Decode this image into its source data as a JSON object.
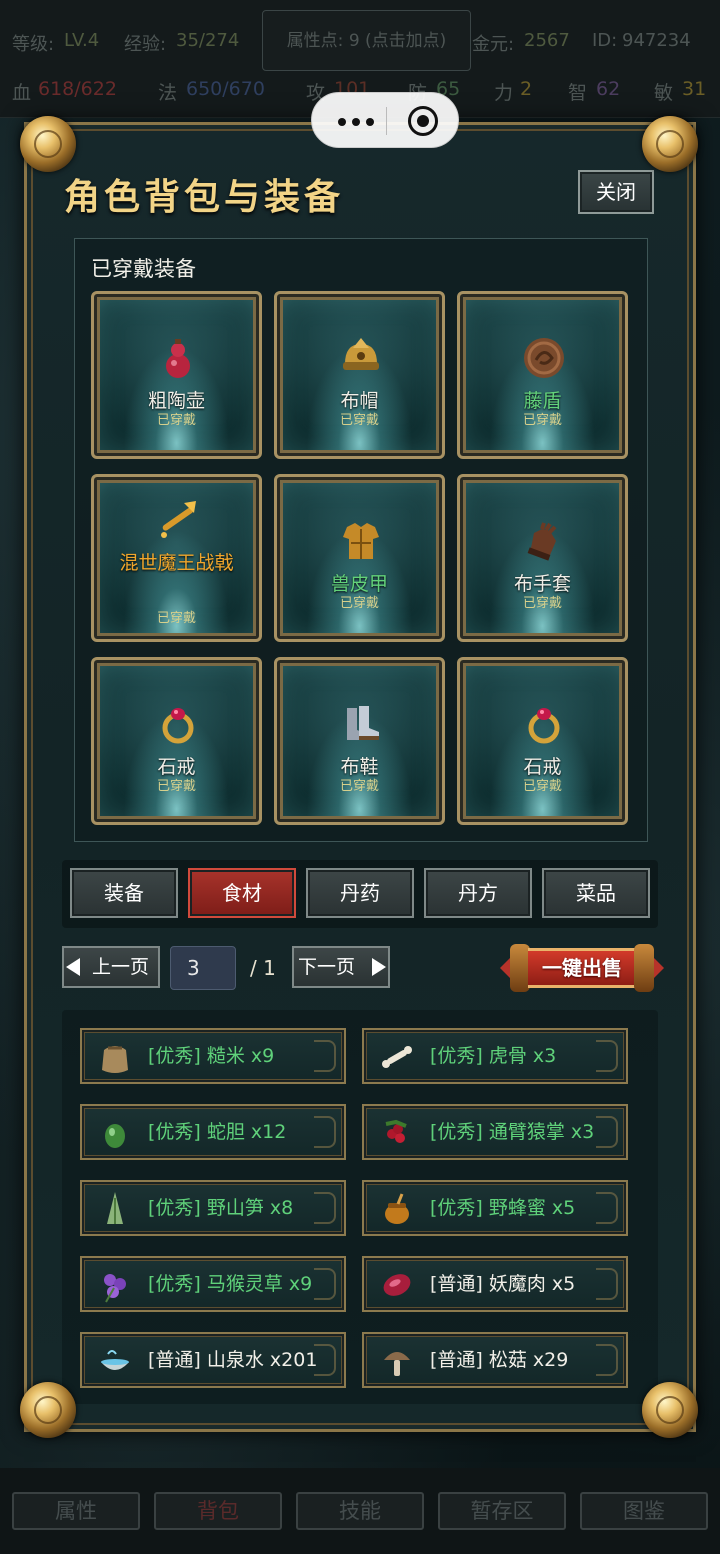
{
  "status": {
    "level_label": "等级:",
    "level_value": "LV.4",
    "exp_label": "经验:",
    "exp_value": "35/274",
    "attr_points": "属性点: 9 (点击加点)",
    "gold_label": "金元:",
    "gold_value": "2567",
    "id_label": "ID:",
    "id_value": "947234",
    "hp_label": "血",
    "hp_value": "618/622",
    "mp_label": "法",
    "mp_value": "650/670",
    "atk_label": "攻",
    "atk_value": "101",
    "def_label": "防",
    "def_value": "65",
    "str_label": "力",
    "str_value": "2",
    "int_label": "智",
    "int_value": "62",
    "agi_label": "敏",
    "agi_value": "31"
  },
  "panel": {
    "title": "角色背包与装备",
    "close_label": "关闭",
    "equipped_title": "已穿戴装备"
  },
  "equipped": [
    {
      "name": "粗陶壶",
      "sub": "已穿戴",
      "icon": "gourd-icon",
      "rarity": "normal"
    },
    {
      "name": "布帽",
      "sub": "已穿戴",
      "icon": "helmet-icon",
      "rarity": "normal"
    },
    {
      "name": "藤盾",
      "sub": "已穿戴",
      "icon": "shield-icon",
      "rarity": "good"
    },
    {
      "name": "混世魔王战戟",
      "sub": "已穿戴",
      "icon": "halberd-icon",
      "rarity": "legendary"
    },
    {
      "name": "兽皮甲",
      "sub": "已穿戴",
      "icon": "armor-icon",
      "rarity": "good"
    },
    {
      "name": "布手套",
      "sub": "已穿戴",
      "icon": "gloves-icon",
      "rarity": "normal"
    },
    {
      "name": "石戒",
      "sub": "已穿戴",
      "icon": "ring-icon",
      "rarity": "normal"
    },
    {
      "name": "布鞋",
      "sub": "已穿戴",
      "icon": "boots-icon",
      "rarity": "normal"
    },
    {
      "name": "石戒",
      "sub": "已穿戴",
      "icon": "ring-icon",
      "rarity": "normal"
    }
  ],
  "tabs": [
    "装备",
    "食材",
    "丹药",
    "丹方",
    "菜品"
  ],
  "active_tab": "食材",
  "pager": {
    "prev": "上一页",
    "next": "下一页",
    "current": "3",
    "total": "/ 1",
    "sell_all": "一键出售"
  },
  "items": [
    {
      "text": "[优秀] 糙米 x9",
      "icon": "rice-sack-icon",
      "quality": "good"
    },
    {
      "text": "[优秀] 虎骨 x3",
      "icon": "bone-icon",
      "quality": "good"
    },
    {
      "text": "[优秀] 蛇胆 x12",
      "icon": "gallbladder-icon",
      "quality": "good"
    },
    {
      "text": "[优秀] 通臂猿掌 x3",
      "icon": "berries-icon",
      "quality": "good"
    },
    {
      "text": "[优秀] 野山笋 x8",
      "icon": "bamboo-shoot-icon",
      "quality": "good"
    },
    {
      "text": "[优秀] 野蜂蜜 x5",
      "icon": "honey-icon",
      "quality": "good"
    },
    {
      "text": "[优秀] 马猴灵草 x9",
      "icon": "herb-icon",
      "quality": "good"
    },
    {
      "text": "[普通] 妖魔肉 x5",
      "icon": "meat-icon",
      "quality": "normal"
    },
    {
      "text": "[普通] 山泉水 x201",
      "icon": "water-bowl-icon",
      "quality": "normal"
    },
    {
      "text": "[普通] 松菇 x29",
      "icon": "mushroom-icon",
      "quality": "normal"
    }
  ],
  "bottom_nav": [
    "属性",
    "背包",
    "技能",
    "暂存区",
    "图鉴"
  ],
  "colors": {
    "gold_title": "#f2d487",
    "good_quality": "#5fd17a",
    "legendary": "#f0a62c",
    "active_tab": "#a8332b"
  }
}
